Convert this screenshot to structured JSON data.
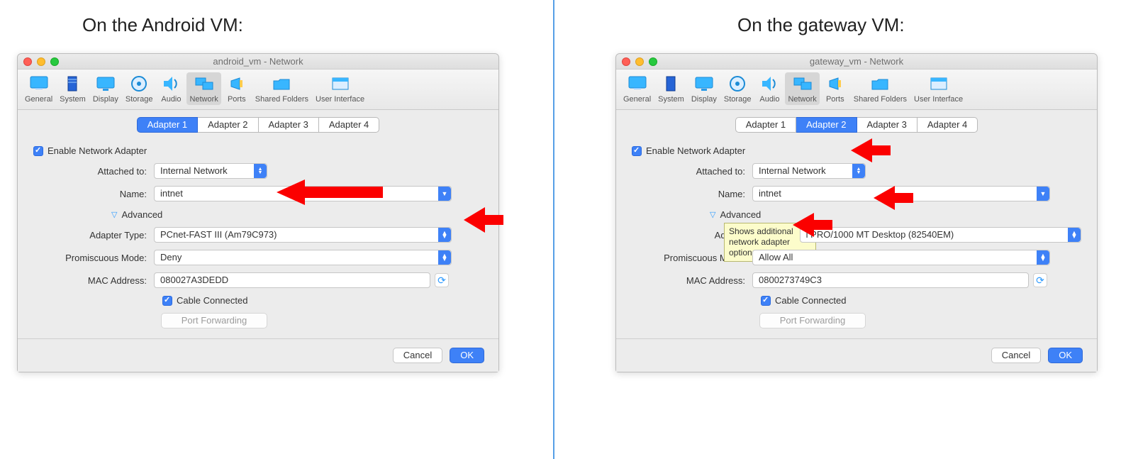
{
  "left_heading": "On the Android VM:",
  "right_heading": "On the gateway VM:",
  "toolbar_items": [
    {
      "label": "General"
    },
    {
      "label": "System"
    },
    {
      "label": "Display"
    },
    {
      "label": "Storage"
    },
    {
      "label": "Audio"
    },
    {
      "label": "Network"
    },
    {
      "label": "Ports"
    },
    {
      "label": "Shared Folders"
    },
    {
      "label": "User Interface"
    }
  ],
  "tabbar": [
    "Adapter 1",
    "Adapter 2",
    "Adapter 3",
    "Adapter 4"
  ],
  "labels": {
    "enable": "Enable Network Adapter",
    "attached": "Attached to:",
    "name": "Name:",
    "advanced": "Advanced",
    "adapter_type": "Adapter Type:",
    "promisc": "Promiscuous Mode:",
    "mac": "MAC Address:",
    "cable": "Cable Connected",
    "port_fwd": "Port Forwarding",
    "cancel": "Cancel",
    "ok": "OK"
  },
  "tooltip_text": "Shows additional network adapter options.",
  "windows": {
    "left": {
      "title": "android_vm - Network",
      "active_tab": 0,
      "enable_checked": true,
      "attached": "Internal Network",
      "name": "intnet",
      "adapter_type": "PCnet-FAST III (Am79C973)",
      "promisc": "Deny",
      "mac": "080027A3DEDD",
      "cable_checked": true
    },
    "right": {
      "title": "gateway_vm - Network",
      "active_tab": 1,
      "enable_checked": true,
      "attached": "Internal Network",
      "name": "intnet",
      "adapter_type_partial": "l PRO/1000 MT Desktop (82540EM)",
      "promisc": "Allow All",
      "mac": "0800273749C3",
      "cable_checked": true
    }
  }
}
